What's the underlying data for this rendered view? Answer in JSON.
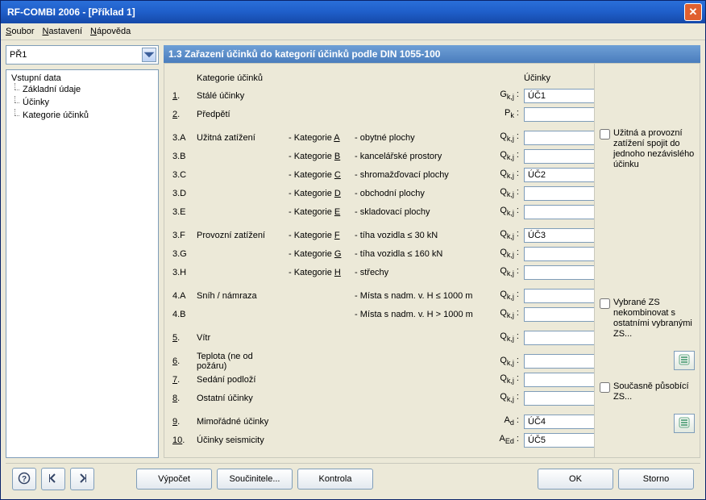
{
  "window": {
    "title": "RF-COMBI 2006 - [Příklad 1]"
  },
  "menu": {
    "file": "Soubor",
    "settings": "Nastavení",
    "help": "Nápověda"
  },
  "selector": {
    "value": "PŘ1"
  },
  "tree": {
    "root": "Vstupní data",
    "items": [
      "Základní údaje",
      "Účinky",
      "Kategorie účinků"
    ]
  },
  "panel_title": "1.3 Zařazení účinků do kategorií účinků podle DIN 1055-100",
  "headers": {
    "category": "Kategorie účinků",
    "actions": "Účinky"
  },
  "rows": [
    {
      "no": "1.",
      "label": "Stálé účinky",
      "cat": "",
      "desc": "",
      "sym": "Gk,j :",
      "val": "ÚČ1"
    },
    {
      "no": "2.",
      "label": "Předpětí",
      "cat": "",
      "desc": "",
      "sym": "Pk :",
      "val": ""
    },
    {
      "no": "3.A",
      "label": "Užitná zatížení",
      "cat": "- Kategorie A",
      "desc": "- obytné plochy",
      "sym": "Qk,j :",
      "val": ""
    },
    {
      "no": "3.B",
      "label": "",
      "cat": "- Kategorie B",
      "desc": "- kancelářské prostory",
      "sym": "Qk,j :",
      "val": ""
    },
    {
      "no": "3.C",
      "label": "",
      "cat": "- Kategorie C",
      "desc": "- shromažďovací plochy",
      "sym": "Qk,j :",
      "val": "ÚČ2"
    },
    {
      "no": "3.D",
      "label": "",
      "cat": "- Kategorie D",
      "desc": "- obchodní plochy",
      "sym": "Qk,j :",
      "val": ""
    },
    {
      "no": "3.E",
      "label": "",
      "cat": "- Kategorie E",
      "desc": "- skladovací plochy",
      "sym": "Qk,j :",
      "val": ""
    },
    {
      "no": "3.F",
      "label": "Provozní zatížení",
      "cat": "- Kategorie F",
      "desc": "- tíha vozidla ≤ 30 kN",
      "sym": "Qk,j :",
      "val": "ÚČ3"
    },
    {
      "no": "3.G",
      "label": "",
      "cat": "- Kategorie G",
      "desc": "- tíha vozidla ≤ 160 kN",
      "sym": "Qk,j :",
      "val": ""
    },
    {
      "no": "3.H",
      "label": "",
      "cat": "- Kategorie H",
      "desc": "- střechy",
      "sym": "Qk,j :",
      "val": ""
    },
    {
      "no": "4.A",
      "label": "Sníh / námraza",
      "cat": "",
      "desc": "- Místa s nadm. v. H ≤ 1000 m",
      "sym": "Qk,j :",
      "val": ""
    },
    {
      "no": "4.B",
      "label": "",
      "cat": "",
      "desc": "- Místa s nadm. v. H > 1000 m",
      "sym": "Qk,j :",
      "val": ""
    },
    {
      "no": "5.",
      "label": "Vítr",
      "cat": "",
      "desc": "",
      "sym": "Qk,j :",
      "val": ""
    },
    {
      "no": "6.",
      "label": "Teplota (ne od požáru)",
      "cat": "",
      "desc": "",
      "sym": "Qk,j :",
      "val": ""
    },
    {
      "no": "7.",
      "label": "Sedání podloží",
      "cat": "",
      "desc": "",
      "sym": "Qk,j :",
      "val": ""
    },
    {
      "no": "8.",
      "label": "Ostatní účinky",
      "cat": "",
      "desc": "",
      "sym": "Qk,j :",
      "val": ""
    },
    {
      "no": "9.",
      "label": "Mimořádné účinky",
      "cat": "",
      "desc": "",
      "sym": "Ad :",
      "val": "ÚČ4"
    },
    {
      "no": "10.",
      "label": "Účinky seismicity",
      "cat": "",
      "desc": "",
      "sym": "AEd :",
      "val": "ÚČ5"
    }
  ],
  "options": {
    "opt1": "Užitná a provozní zatížení spojit do jednoho nezávislého účinku",
    "opt2": "Vybrané ZS nekombinovat s ostatními vybranými ZS...",
    "opt3": "Současně působící ZS..."
  },
  "buttons": {
    "calc": "Výpočet",
    "factors": "Součinitele...",
    "check": "Kontrola",
    "ok": "OK",
    "cancel": "Storno"
  }
}
